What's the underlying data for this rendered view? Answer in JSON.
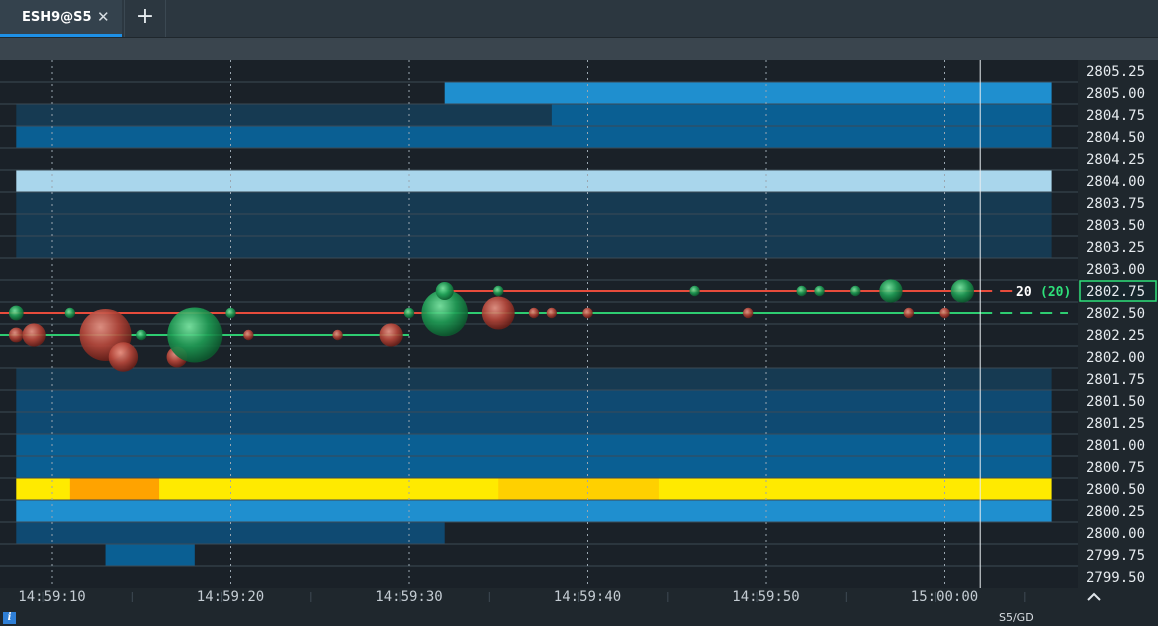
{
  "tab": {
    "label": "ESH9@S5",
    "close_glyph": "✕",
    "add_glyph": "+"
  },
  "status": {
    "mode": "S5/GD",
    "info_glyph": "i"
  },
  "colors": {
    "buy": "#27c46a",
    "sell": "#d84a3c",
    "bid_line": "#2ecc71",
    "ask_line": "#e74c3c"
  },
  "last_trade": {
    "size": "20",
    "cumulative": "(20)",
    "price": "2802.75"
  },
  "price_levels": [
    "2805.25",
    "2805.00",
    "2804.75",
    "2804.50",
    "2804.25",
    "2804.00",
    "2803.75",
    "2803.50",
    "2803.25",
    "2803.00",
    "2802.75",
    "2802.50",
    "2802.25",
    "2802.00",
    "2801.75",
    "2801.50",
    "2801.25",
    "2801.00",
    "2800.75",
    "2800.50",
    "2800.25",
    "2800.00",
    "2799.75",
    "2799.50"
  ],
  "time_labels": [
    "14:59:10",
    "14:59:20",
    "14:59:30",
    "14:59:40",
    "14:59:50",
    "15:00:00"
  ],
  "chart_data": {
    "type": "heatmap",
    "title": "",
    "x_range": [
      "14:59:08",
      "15:00:06"
    ],
    "y_range": [
      2799.5,
      2805.25
    ],
    "liquidity_rows": [
      {
        "price": 2805.0,
        "segments": [
          {
            "from": "14:59:32",
            "to": "15:00:06",
            "level": "medium-high"
          }
        ]
      },
      {
        "price": 2804.75,
        "segments": [
          {
            "from": "14:59:08",
            "to": "14:59:38",
            "level": "low"
          },
          {
            "from": "14:59:38",
            "to": "15:00:06",
            "level": "medium"
          }
        ]
      },
      {
        "price": 2804.5,
        "segments": [
          {
            "from": "14:59:08",
            "to": "15:00:06",
            "level": "medium"
          }
        ]
      },
      {
        "price": 2804.0,
        "segments": [
          {
            "from": "14:59:08",
            "to": "15:00:06",
            "level": "very-high"
          }
        ]
      },
      {
        "price": 2803.75,
        "segments": [
          {
            "from": "14:59:08",
            "to": "15:00:06",
            "level": "low"
          }
        ]
      },
      {
        "price": 2803.5,
        "segments": [
          {
            "from": "14:59:08",
            "to": "15:00:06",
            "level": "low"
          }
        ]
      },
      {
        "price": 2803.25,
        "segments": [
          {
            "from": "14:59:08",
            "to": "15:00:06",
            "level": "low"
          }
        ]
      },
      {
        "price": 2801.75,
        "segments": [
          {
            "from": "14:59:08",
            "to": "15:00:06",
            "level": "low"
          }
        ]
      },
      {
        "price": 2801.5,
        "segments": [
          {
            "from": "14:59:08",
            "to": "15:00:06",
            "level": "low-medium"
          }
        ]
      },
      {
        "price": 2801.25,
        "segments": [
          {
            "from": "14:59:08",
            "to": "15:00:06",
            "level": "low-medium"
          }
        ]
      },
      {
        "price": 2801.0,
        "segments": [
          {
            "from": "14:59:08",
            "to": "15:00:06",
            "level": "medium"
          }
        ]
      },
      {
        "price": 2800.75,
        "segments": [
          {
            "from": "14:59:08",
            "to": "15:00:06",
            "level": "medium"
          }
        ]
      },
      {
        "price": 2800.5,
        "segments": [
          {
            "from": "14:59:08",
            "to": "15:00:06",
            "level": "max"
          }
        ]
      },
      {
        "price": 2800.25,
        "segments": [
          {
            "from": "14:59:08",
            "to": "15:00:06",
            "level": "medium-high"
          }
        ]
      },
      {
        "price": 2800.0,
        "segments": [
          {
            "from": "14:59:08",
            "to": "14:59:32",
            "level": "low-medium"
          }
        ]
      },
      {
        "price": 2799.75,
        "segments": [
          {
            "from": "14:59:13",
            "to": "14:59:18",
            "level": "medium"
          }
        ]
      }
    ],
    "best_ask": {
      "price": 2802.75,
      "from": "14:59:32"
    },
    "best_bid": {
      "price": 2802.5
    },
    "trades": [
      {
        "t": "14:59:08",
        "price": 2802.5,
        "side": "buy",
        "size": 2
      },
      {
        "t": "14:59:08",
        "price": 2802.25,
        "side": "sell",
        "size": 2
      },
      {
        "t": "14:59:09",
        "price": 2802.25,
        "side": "sell",
        "size": 5
      },
      {
        "t": "14:59:11",
        "price": 2802.5,
        "side": "buy",
        "size": 1
      },
      {
        "t": "14:59:13",
        "price": 2802.25,
        "side": "sell",
        "size": 25
      },
      {
        "t": "14:59:14",
        "price": 2802.0,
        "side": "sell",
        "size": 8
      },
      {
        "t": "14:59:15",
        "price": 2802.25,
        "side": "buy",
        "size": 1
      },
      {
        "t": "14:59:17",
        "price": 2802.0,
        "side": "sell",
        "size": 4
      },
      {
        "t": "14:59:18",
        "price": 2802.25,
        "side": "buy",
        "size": 28
      },
      {
        "t": "14:59:20",
        "price": 2802.5,
        "side": "buy",
        "size": 1
      },
      {
        "t": "14:59:21",
        "price": 2802.25,
        "side": "sell",
        "size": 1
      },
      {
        "t": "14:59:26",
        "price": 2802.25,
        "side": "sell",
        "size": 1
      },
      {
        "t": "14:59:29",
        "price": 2802.25,
        "side": "sell",
        "size": 5
      },
      {
        "t": "14:59:30",
        "price": 2802.5,
        "side": "buy",
        "size": 1
      },
      {
        "t": "14:59:32",
        "price": 2802.5,
        "side": "buy",
        "size": 20
      },
      {
        "t": "14:59:32",
        "price": 2802.75,
        "side": "buy",
        "size": 3
      },
      {
        "t": "14:59:35",
        "price": 2802.75,
        "side": "buy",
        "size": 1
      },
      {
        "t": "14:59:35",
        "price": 2802.5,
        "side": "sell",
        "size": 10
      },
      {
        "t": "14:59:37",
        "price": 2802.5,
        "side": "sell",
        "size": 1
      },
      {
        "t": "14:59:38",
        "price": 2802.5,
        "side": "sell",
        "size": 1
      },
      {
        "t": "14:59:40",
        "price": 2802.5,
        "side": "sell",
        "size": 1
      },
      {
        "t": "14:59:46",
        "price": 2802.75,
        "side": "buy",
        "size": 1
      },
      {
        "t": "14:59:49",
        "price": 2802.5,
        "side": "sell",
        "size": 1
      },
      {
        "t": "14:59:52",
        "price": 2802.75,
        "side": "buy",
        "size": 1
      },
      {
        "t": "14:59:53",
        "price": 2802.75,
        "side": "buy",
        "size": 1
      },
      {
        "t": "14:59:55",
        "price": 2802.75,
        "side": "buy",
        "size": 1
      },
      {
        "t": "14:59:57",
        "price": 2802.75,
        "side": "buy",
        "size": 5
      },
      {
        "t": "14:59:58",
        "price": 2802.5,
        "side": "sell",
        "size": 1
      },
      {
        "t": "15:00:00",
        "price": 2802.5,
        "side": "sell",
        "size": 1
      },
      {
        "t": "15:00:01",
        "price": 2802.75,
        "side": "buy",
        "size": 5
      }
    ],
    "current_time": "15:00:02"
  }
}
